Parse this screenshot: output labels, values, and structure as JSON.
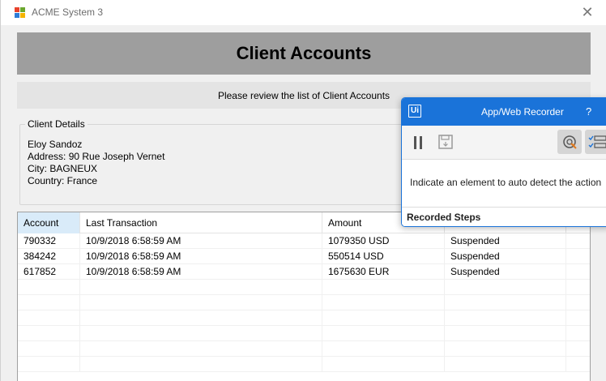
{
  "window": {
    "title": "ACME System 3",
    "close_glyph": "✕"
  },
  "header": {
    "title": "Client Accounts"
  },
  "subheader": {
    "text": "Please review the list of Client Accounts"
  },
  "client_details": {
    "legend": "Client Details",
    "lines": [
      "Eloy Sandoz",
      "Address: 90 Rue Joseph Vernet",
      "City: BAGNEUX",
      "Country: France"
    ]
  },
  "grid": {
    "columns": [
      "Account",
      "Last Transaction",
      "Amount",
      ""
    ],
    "rows": [
      [
        "790332",
        "10/9/2018 6:58:59 AM",
        "1079350 USD",
        "Suspended"
      ],
      [
        "384242",
        "10/9/2018 6:58:59 AM",
        "550514 USD",
        "Suspended"
      ],
      [
        "617852",
        "10/9/2018 6:58:59 AM",
        "1675630 EUR",
        "Suspended"
      ]
    ],
    "empty_rows": 6
  },
  "recorder": {
    "logo": "Ui",
    "title": "App/Web Recorder",
    "help": "?",
    "message": "Indicate an element to auto detect the action",
    "steps_label": "Recorded Steps",
    "icons": [
      "pause-icon",
      "save-icon",
      "target-icon",
      "checklist-icon"
    ]
  },
  "colors": {
    "banner": "#9e9e9e",
    "recorder_accent": "#1a73d9",
    "sorted_header": "#d9ebf9"
  }
}
